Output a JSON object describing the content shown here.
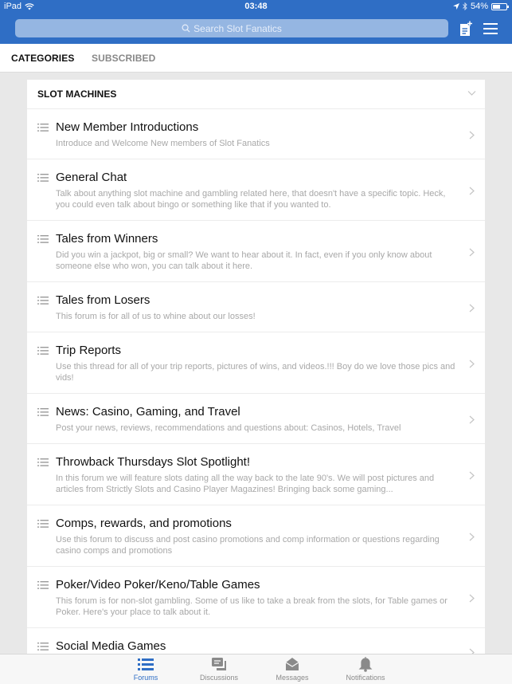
{
  "status_bar": {
    "device": "iPad",
    "time": "03:48",
    "battery": "54%",
    "battery_level": 0.54
  },
  "header": {
    "search_placeholder": "Search Slot Fanatics",
    "compose_icon": "new-post-icon",
    "menu_icon": "hamburger-menu-icon",
    "accent_color": "#2f6ec5"
  },
  "tabs": [
    {
      "label": "CATEGORIES",
      "active": true
    },
    {
      "label": "SUBSCRIBED",
      "active": false
    }
  ],
  "category": {
    "title": "SLOT MACHINES",
    "forums": [
      {
        "title": "New Member Introductions",
        "description": "Introduce and Welcome New members of Slot Fanatics"
      },
      {
        "title": "General Chat",
        "description": "Talk about anything slot machine and gambling related here, that doesn't have a specific topic. Heck, you could even talk about bingo or something like that if you wanted to."
      },
      {
        "title": "Tales from Winners",
        "description": "Did you win a jackpot, big or small? We want to hear about it. In fact, even if you only know about someone else who won, you can talk about it here."
      },
      {
        "title": "Tales from Losers",
        "description": "This forum is for all of us to whine about our losses!"
      },
      {
        "title": "Trip Reports",
        "description": "Use this thread for all of your trip reports, pictures of wins, and videos.!!! Boy do we love those pics and vids!"
      },
      {
        "title": "News: Casino, Gaming, and Travel",
        "description": "Post your news, reviews, recommendations and questions about: Casinos, Hotels, Travel"
      },
      {
        "title": "Throwback Thursdays Slot Spotlight!",
        "description": "In this forum we will feature slots dating all the way back to the late 90's. We will post pictures and articles from Strictly Slots and Casino Player Magazines! Bringing back some gaming..."
      },
      {
        "title": "Comps, rewards, and promotions",
        "description": "Use this forum to discuss and post casino promotions and comp information or questions regarding casino comps and promotions"
      },
      {
        "title": "Poker/Video Poker/Keno/Table Games",
        "description": "This forum is for non-slot gambling. Some of us like to take a break from the slots, for Table games or Poker. Here's your place to talk about it."
      },
      {
        "title": "Social Media Games",
        "description": ""
      }
    ]
  },
  "bottom_nav": [
    {
      "label": "Forums",
      "icon": "list-icon",
      "active": true
    },
    {
      "label": "Discussions",
      "icon": "chat-bubbles-icon",
      "active": false
    },
    {
      "label": "Messages",
      "icon": "envelope-icon",
      "active": false
    },
    {
      "label": "Notifications",
      "icon": "bell-icon",
      "active": false
    }
  ]
}
